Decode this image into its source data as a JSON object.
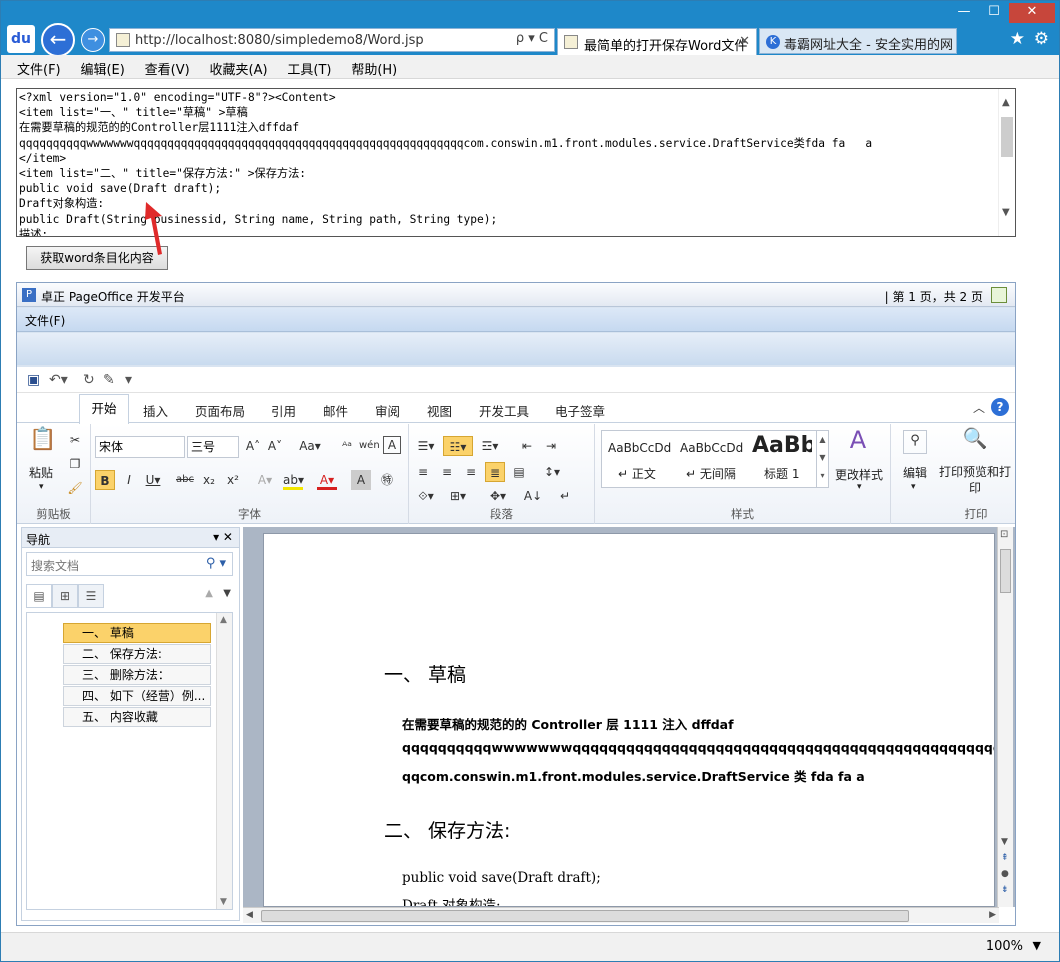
{
  "browser": {
    "url": "http://localhost:8080/simpledemo8/Word.jsp",
    "address_controls": "ρ ▾ C",
    "active_tab": "最简单的打开保存Word文件",
    "inactive_tab": "毒霸网址大全 - 安全实用的网...",
    "logo": "du",
    "minimize": "—",
    "maximize": "☐",
    "close": "✕"
  },
  "menubar": [
    "文件(F)",
    "编辑(E)",
    "查看(V)",
    "收藏夹(A)",
    "工具(T)",
    "帮助(H)"
  ],
  "xml_text": "<?xml version=\"1.0\" encoding=\"UTF-8\"?><Content>\n<item list=\"一、\" title=\"草稿\" >草稿\n在需要草稿的规范的的Controller层1111注入dffdaf\nqqqqqqqqqqwwwwwwwqqqqqqqqqqqqqqqqqqqqqqqqqqqqqqqqqqqqqqqqqqqqqqqqqcom.conswin.m1.front.modules.service.DraftService类fda fa   a\n</item>\n<item list=\"二、\" title=\"保存方法:\" >保存方法:\npublic void save(Draft draft);\nDraft对象构造:\npublic Draft(String businessid, String name, String path, String type);\n描述:",
  "get_button": "获取word条目化内容",
  "pageoffice": {
    "title": "卓正 PageOffice 开发平台",
    "page_info": "| 第 1 页，共 2 页",
    "file_menu": "文件(F)"
  },
  "ribbon": {
    "tabs": [
      "开始",
      "插入",
      "页面布局",
      "引用",
      "邮件",
      "审阅",
      "视图",
      "开发工具",
      "电子签章"
    ],
    "font_name": "宋体",
    "font_size": "三号",
    "groups": [
      "剪贴板",
      "字体",
      "段落",
      "样式",
      "打印"
    ],
    "paste": "粘贴",
    "styles": [
      {
        "preview": "AaBbCcDd",
        "name": "↵ 正文"
      },
      {
        "preview": "AaBbCcDd",
        "name": "↵ 无间隔"
      },
      {
        "preview": "AaBb",
        "name": "标题 1"
      }
    ],
    "change_styles": "更改样式",
    "edit": "编辑",
    "print_preview": "打印预览和打印"
  },
  "nav": {
    "title": "导航",
    "search_placeholder": "搜索文档",
    "items": [
      "一、  草稿",
      "二、  保存方法:",
      "三、  删除方法：",
      "四、  如下（经营）例...",
      "五、  内容收藏"
    ]
  },
  "doc": {
    "h1": "一、   草稿",
    "p1": "在需要草稿的规范的的 Controller 层 1111 注入 dffdaf",
    "p2": "qqqqqqqqqqwwwwwwwqqqqqqqqqqqqqqqqqqqqqqqqqqqqqqqqqqqqqqqqqqqqqqqqqq",
    "p3": "qqcom.conswin.m1.front.modules.service.DraftService 类 fda fa     a",
    "h2": "二、   保存方法:",
    "c1": "public void save(Draft draft);",
    "c2": "Draft 对象构造:"
  },
  "status": {
    "zoom": "100%"
  },
  "colors": {
    "accent": "#1e88c9",
    "nav_selected": "#fbd26a",
    "arrow": "#e02a2a"
  }
}
